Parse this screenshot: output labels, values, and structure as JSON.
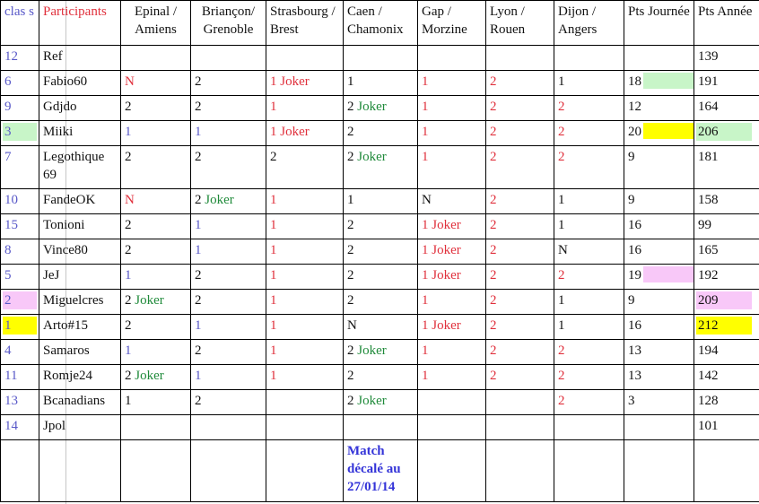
{
  "headers": [
    {
      "label": "clas s",
      "color": "blue"
    },
    {
      "label": "Participants",
      "color": "red"
    },
    {
      "label": "Epinal / Amiens",
      "color": "black",
      "align": "center"
    },
    {
      "label": "Briançon/ Grenoble",
      "color": "black",
      "align": "center"
    },
    {
      "label": "Strasbourg / Brest",
      "color": "black"
    },
    {
      "label": "Caen / Chamonix",
      "color": "black"
    },
    {
      "label": "Gap / Morzine",
      "color": "black"
    },
    {
      "label": "Lyon / Rouen",
      "color": "black"
    },
    {
      "label": "Dijon / Angers",
      "color": "black"
    },
    {
      "label": "Pts Journée",
      "color": "black"
    },
    {
      "label": "Pts Année",
      "color": "black"
    }
  ],
  "colors": {
    "rank": "#5858c8",
    "participants_header": "#e0303c",
    "red_pick": "#e0303c",
    "blue_pick": "#5858c8",
    "joker": "#1f8a3a",
    "note": "#3434d8",
    "highlight_green": "#c8f5c8",
    "highlight_yellow": "#ffff00",
    "highlight_pink": "#f8c8f8"
  },
  "rows": [
    {
      "rank": "12",
      "name": "Ref",
      "picks": [
        {
          "v": ""
        },
        {
          "v": ""
        },
        {
          "v": ""
        },
        {
          "v": ""
        },
        {
          "v": ""
        },
        {
          "v": ""
        },
        {
          "v": ""
        }
      ],
      "pts_day": "",
      "pts_year": "139"
    },
    {
      "rank": "6",
      "name": "Fabio60",
      "picks": [
        {
          "v": "N",
          "c": "red"
        },
        {
          "v": "2",
          "c": "black"
        },
        {
          "v": "1",
          "c": "red",
          "joker": "Joker",
          "jc": "red"
        },
        {
          "v": "1",
          "c": "black"
        },
        {
          "v": "1",
          "c": "red"
        },
        {
          "v": "2",
          "c": "red"
        },
        {
          "v": "1",
          "c": "black"
        }
      ],
      "pts_day": "18",
      "pts_day_hl": "green",
      "pts_year": "191"
    },
    {
      "rank": "9",
      "name": "Gdjdo",
      "picks": [
        {
          "v": "2",
          "c": "black"
        },
        {
          "v": "2",
          "c": "black"
        },
        {
          "v": "1",
          "c": "red"
        },
        {
          "v": "2",
          "c": "black",
          "joker": "Joker",
          "jc": "green"
        },
        {
          "v": "1",
          "c": "red"
        },
        {
          "v": "2",
          "c": "red"
        },
        {
          "v": "2",
          "c": "red"
        }
      ],
      "pts_day": "12",
      "pts_year": "164"
    },
    {
      "rank": "3",
      "rank_hl": "green",
      "name": "Miiki",
      "picks": [
        {
          "v": "1",
          "c": "blue"
        },
        {
          "v": "1",
          "c": "blue"
        },
        {
          "v": "1",
          "c": "red",
          "joker": "Joker",
          "jc": "red"
        },
        {
          "v": "2",
          "c": "black"
        },
        {
          "v": "1",
          "c": "red"
        },
        {
          "v": "2",
          "c": "red"
        },
        {
          "v": "2",
          "c": "red"
        }
      ],
      "pts_day": "20",
      "pts_day_hl": "yellow",
      "pts_year": "206",
      "pts_year_hl": "green"
    },
    {
      "rank": "7",
      "name": "Legothique 69",
      "tall": true,
      "picks": [
        {
          "v": "2",
          "c": "black"
        },
        {
          "v": "2",
          "c": "black"
        },
        {
          "v": "2",
          "c": "black"
        },
        {
          "v": "2",
          "c": "black",
          "joker": "Joker",
          "jc": "green"
        },
        {
          "v": "1",
          "c": "red"
        },
        {
          "v": "2",
          "c": "red"
        },
        {
          "v": "2",
          "c": "red"
        }
      ],
      "pts_day": "9",
      "pts_year": "181"
    },
    {
      "rank": "10",
      "name": "FandeOK",
      "picks": [
        {
          "v": "N",
          "c": "red"
        },
        {
          "v": "2",
          "c": "black",
          "joker": "Joker",
          "jc": "green"
        },
        {
          "v": "1",
          "c": "red"
        },
        {
          "v": "1",
          "c": "black"
        },
        {
          "v": "N",
          "c": "black"
        },
        {
          "v": "2",
          "c": "red"
        },
        {
          "v": "1",
          "c": "black"
        }
      ],
      "pts_day": "9",
      "pts_year": "158"
    },
    {
      "rank": "15",
      "name": "Tonioni",
      "picks": [
        {
          "v": "2",
          "c": "black"
        },
        {
          "v": "1",
          "c": "blue"
        },
        {
          "v": "1",
          "c": "red"
        },
        {
          "v": "2",
          "c": "black"
        },
        {
          "v": "1",
          "c": "red",
          "joker": "Joker",
          "jc": "red"
        },
        {
          "v": "2",
          "c": "red"
        },
        {
          "v": "1",
          "c": "black"
        }
      ],
      "pts_day": "16",
      "pts_year": "99"
    },
    {
      "rank": "8",
      "name": "Vince80",
      "picks": [
        {
          "v": "2",
          "c": "black"
        },
        {
          "v": "1",
          "c": "blue"
        },
        {
          "v": "1",
          "c": "red"
        },
        {
          "v": "2",
          "c": "black"
        },
        {
          "v": "1",
          "c": "red",
          "joker": "Joker",
          "jc": "red"
        },
        {
          "v": "2",
          "c": "red"
        },
        {
          "v": "N",
          "c": "black"
        }
      ],
      "pts_day": "16",
      "pts_year": "165"
    },
    {
      "rank": "5",
      "name": "JeJ",
      "picks": [
        {
          "v": "1",
          "c": "blue"
        },
        {
          "v": "2",
          "c": "black"
        },
        {
          "v": "1",
          "c": "red"
        },
        {
          "v": "2",
          "c": "black"
        },
        {
          "v": "1",
          "c": "red",
          "joker": "Joker",
          "jc": "red"
        },
        {
          "v": "2",
          "c": "red"
        },
        {
          "v": "2",
          "c": "red"
        }
      ],
      "pts_day": "19",
      "pts_day_hl": "pink",
      "pts_year": "192"
    },
    {
      "rank": "2",
      "rank_hl": "pink",
      "name": "Miguelcres",
      "picks": [
        {
          "v": "2",
          "c": "black",
          "joker": "Joker",
          "jc": "green"
        },
        {
          "v": "2",
          "c": "black"
        },
        {
          "v": "1",
          "c": "red"
        },
        {
          "v": "2",
          "c": "black"
        },
        {
          "v": "1",
          "c": "red"
        },
        {
          "v": "2",
          "c": "red"
        },
        {
          "v": "1",
          "c": "black"
        }
      ],
      "pts_day": "9",
      "pts_year": "209",
      "pts_year_hl": "pink"
    },
    {
      "rank": "1",
      "rank_hl": "yellow",
      "name": "Arto#15",
      "picks": [
        {
          "v": "2",
          "c": "black"
        },
        {
          "v": "1",
          "c": "blue"
        },
        {
          "v": "1",
          "c": "red"
        },
        {
          "v": "N",
          "c": "black"
        },
        {
          "v": "1",
          "c": "red",
          "joker": "Joker",
          "jc": "red"
        },
        {
          "v": "2",
          "c": "red"
        },
        {
          "v": "1",
          "c": "black"
        }
      ],
      "pts_day": "16",
      "pts_year": "212",
      "pts_year_hl": "yellow"
    },
    {
      "rank": "4",
      "name": "Samaros",
      "picks": [
        {
          "v": "1",
          "c": "blue"
        },
        {
          "v": "2",
          "c": "black"
        },
        {
          "v": "1",
          "c": "red"
        },
        {
          "v": "2",
          "c": "black",
          "joker": "Joker",
          "jc": "green"
        },
        {
          "v": "1",
          "c": "red"
        },
        {
          "v": "2",
          "c": "red"
        },
        {
          "v": "2",
          "c": "red"
        }
      ],
      "pts_day": "13",
      "pts_year": "194"
    },
    {
      "rank": "11",
      "name": "Romje24",
      "picks": [
        {
          "v": "2",
          "c": "black",
          "joker": "Joker",
          "jc": "green"
        },
        {
          "v": "1",
          "c": "blue"
        },
        {
          "v": "1",
          "c": "red"
        },
        {
          "v": "2",
          "c": "black"
        },
        {
          "v": "1",
          "c": "red"
        },
        {
          "v": "2",
          "c": "red"
        },
        {
          "v": "2",
          "c": "red"
        }
      ],
      "pts_day": "13",
      "pts_year": "142"
    },
    {
      "rank": "13",
      "name": "Bcanadians",
      "picks": [
        {
          "v": "1",
          "c": "black"
        },
        {
          "v": "2",
          "c": "black"
        },
        {
          "v": ""
        },
        {
          "v": "2",
          "c": "black",
          "joker": "Joker",
          "jc": "green"
        },
        {
          "v": ""
        },
        {
          "v": ""
        },
        {
          "v": "2",
          "c": "red"
        }
      ],
      "pts_day": "3",
      "pts_year": "128"
    },
    {
      "rank": "14",
      "name": "Jpol",
      "picks": [
        {
          "v": ""
        },
        {
          "v": ""
        },
        {
          "v": ""
        },
        {
          "v": ""
        },
        {
          "v": ""
        },
        {
          "v": ""
        },
        {
          "v": ""
        }
      ],
      "pts_day": "",
      "pts_year": "101"
    }
  ],
  "footer_note": {
    "column": 3,
    "text": "Match décalé au 27/01/14"
  }
}
